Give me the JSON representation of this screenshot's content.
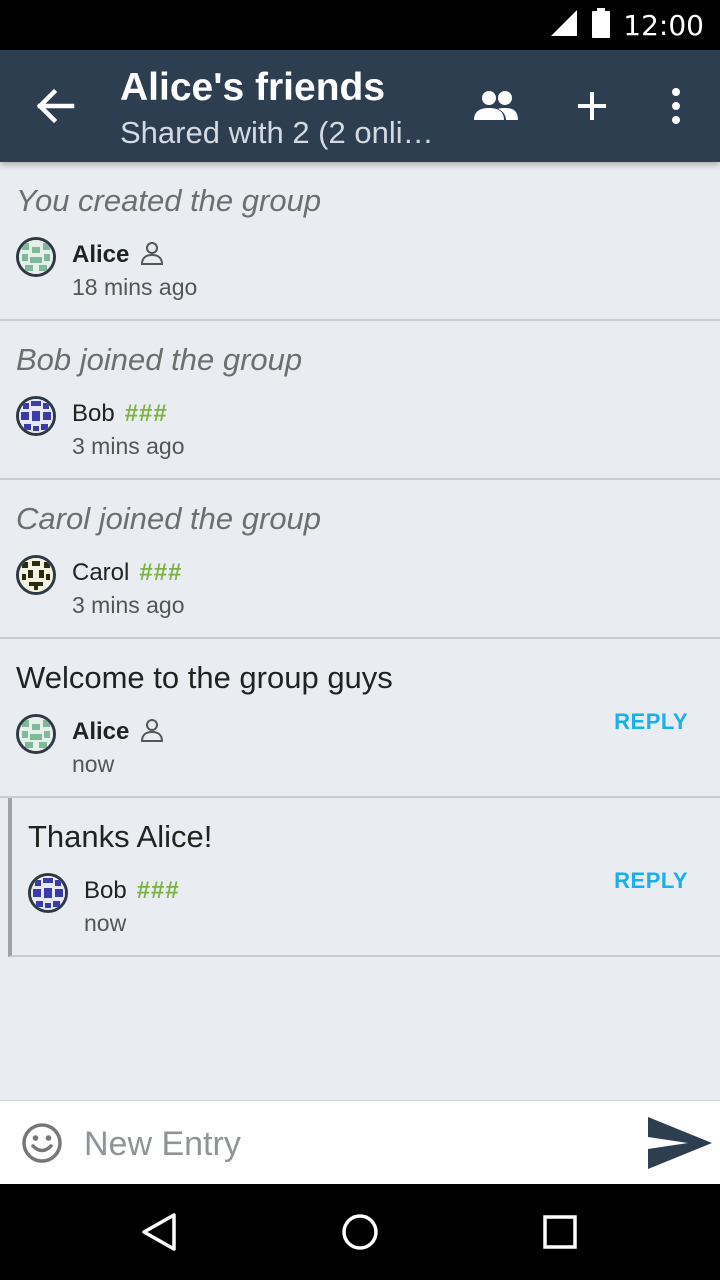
{
  "status_bar": {
    "time": "12:00"
  },
  "toolbar": {
    "title": "Alice's friends",
    "subtitle": "Shared with 2 (2 onli…"
  },
  "entries": [
    {
      "text": "You created the group",
      "system": true,
      "author": "Alice",
      "author_is_me": true,
      "time": "18 mins ago",
      "reply": ""
    },
    {
      "text": "Bob joined the group",
      "system": true,
      "author": "Bob",
      "author_is_me": false,
      "trust": "###",
      "time": "3 mins ago",
      "reply": ""
    },
    {
      "text": "Carol joined the group",
      "system": true,
      "author": "Carol",
      "author_is_me": false,
      "trust": "###",
      "time": "3 mins ago",
      "reply": ""
    },
    {
      "text": "Welcome to the group guys",
      "system": false,
      "author": "Alice",
      "author_is_me": true,
      "time": "now",
      "reply": "REPLY"
    },
    {
      "text": "Thanks Alice!",
      "system": false,
      "author": "Bob",
      "author_is_me": false,
      "trust": "###",
      "time": "now",
      "reply": "REPLY"
    }
  ],
  "composer": {
    "placeholder": "New Entry",
    "value": ""
  },
  "colors": {
    "toolbar": "#2c3e50",
    "background": "#e9ecf0",
    "reply": "#1ab0ea",
    "trust": "#7cb342"
  },
  "icons": {
    "status": [
      "signal-icon",
      "battery-icon"
    ],
    "toolbar": [
      "back-arrow-icon",
      "group-members-icon",
      "add-icon",
      "more-vert-icon"
    ],
    "composer": [
      "emoji-icon",
      "send-icon"
    ],
    "nav": [
      "nav-back-icon",
      "nav-home-icon",
      "nav-recents-icon"
    ]
  }
}
